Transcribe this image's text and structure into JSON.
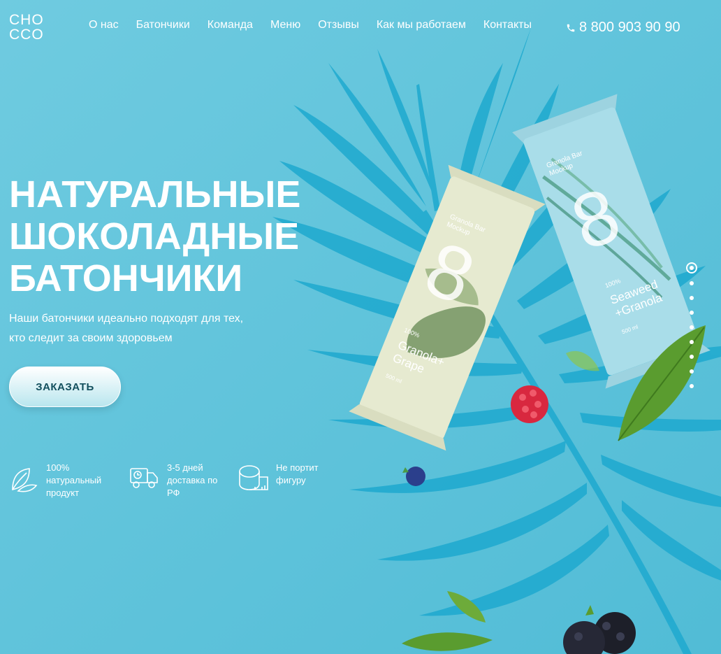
{
  "logo": {
    "line1": "CHO",
    "line2": "CCO"
  },
  "nav": {
    "items": [
      {
        "label": "О нас"
      },
      {
        "label": "Батончики"
      },
      {
        "label": "Команда"
      },
      {
        "label": "Меню"
      },
      {
        "label": "Отзывы"
      },
      {
        "label": "Как мы работаем"
      },
      {
        "label": "Контакты"
      }
    ]
  },
  "phone": {
    "number": "8 800 903 90 90",
    "icon": "phone-icon"
  },
  "hero": {
    "title_lines": [
      "НАТУРАЛЬНЫЕ",
      "ШОКОЛАДНЫЕ",
      "БАТОНЧИКИ"
    ],
    "subtitle_lines": [
      "Наши батончики идеально подходят для тех,",
      "кто следит за своим здоровьем"
    ],
    "order_button": "ЗАКАЗАТЬ"
  },
  "features": [
    {
      "icon": "leaf-icon",
      "lines": [
        "100%",
        "натуральный",
        "продукт"
      ]
    },
    {
      "icon": "delivery-truck-icon",
      "lines": [
        "3-5 дней",
        "доставка по",
        "РФ"
      ]
    },
    {
      "icon": "measuring-tape-icon",
      "lines": [
        "Не портит",
        "фигуру"
      ]
    }
  ],
  "bars": [
    {
      "number": "8",
      "caption_lines": [
        "Granola Bar",
        "Mockup"
      ],
      "percent": "100%",
      "flavor_lines": [
        "Granola+",
        "Grape"
      ],
      "volume": "500 ml",
      "color": "#e6ead0"
    },
    {
      "number": "8",
      "caption_lines": [
        "Granola Bar",
        "Mockup"
      ],
      "percent": "100%",
      "flavor_lines": [
        "Seaweed",
        "+Granola"
      ],
      "volume": "500 ml",
      "color": "#a9dde9"
    }
  ],
  "slider": {
    "count": 9,
    "active": 1
  },
  "colors": {
    "background": "#5ec3d9",
    "leaf_shadow": "#1ea9cf",
    "button_text": "#13505e"
  }
}
